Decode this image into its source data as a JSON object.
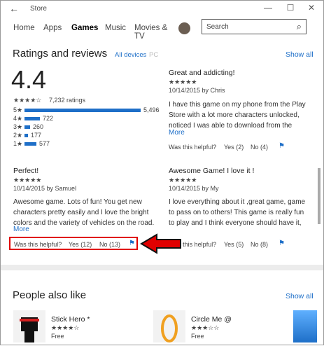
{
  "window": {
    "title": "Store",
    "back_glyph": "←",
    "min_glyph": "—",
    "max_glyph": "☐",
    "close_glyph": "✕"
  },
  "nav": {
    "tabs": [
      "Home",
      "Apps",
      "Games",
      "Music",
      "Movies & TV"
    ],
    "active": "Games"
  },
  "search": {
    "placeholder": "Search"
  },
  "ratings": {
    "heading": "Ratings and reviews",
    "filter_all": "All devices",
    "filter_pc": "PC",
    "show_all": "Show all",
    "average": "4.4",
    "stars": "★★★★☆",
    "count_text": "7,232 ratings",
    "distribution": [
      {
        "label": "5★",
        "count": "5,496",
        "fraction": 1.0
      },
      {
        "label": "4★",
        "count": "722",
        "fraction": 0.131
      },
      {
        "label": "3★",
        "count": "260",
        "fraction": 0.047
      },
      {
        "label": "2★",
        "count": "177",
        "fraction": 0.032
      },
      {
        "label": "1★",
        "count": "577",
        "fraction": 0.105
      }
    ]
  },
  "reviews": [
    {
      "title": "Great and addicting!",
      "stars": "★★★★★",
      "meta": "10/14/2015 by Chris",
      "body": "I have this game on my phone from the Play Store with a lot more characters unlocked, noticed I was able to download from the",
      "more": "More",
      "helpful": "Was this helpful?",
      "yes": "Yes",
      "yes_count": "(2)",
      "no": "No",
      "no_count": "(4)"
    },
    {
      "title": "Perfect!",
      "stars": "★★★★★",
      "meta": "10/14/2015 by Samuel",
      "body": "Awesome game. Lots of fun! You get new characters pretty easily and I love the bright colors and the variety of vehicles on the road.",
      "more": "More",
      "helpful": "Was this helpful?",
      "yes": "Yes",
      "yes_count": "(12)",
      "no": "No",
      "no_count": "(13)"
    },
    {
      "title": "Awesome Game! I love it !",
      "stars": "★★★★★",
      "meta": "10/14/2015 by My",
      "body": "I love everything about it ,great game, game to pass on to others! This game is really fun to play and I think everyone should have it,",
      "more": "",
      "helpful": "Was this helpful?",
      "yes": "Yes",
      "yes_count": "(5)",
      "no": "No",
      "no_count": "(8)"
    }
  ],
  "people": {
    "heading": "People also like",
    "show_all": "Show all",
    "apps": [
      {
        "name": "Stick Hero *",
        "stars": "★★★★☆",
        "price": "Free"
      },
      {
        "name": "Circle Me @",
        "stars": "★★★☆☆",
        "price": "Free"
      }
    ]
  },
  "colors": {
    "accent": "#1e6fc8",
    "highlight": "#e00000"
  }
}
